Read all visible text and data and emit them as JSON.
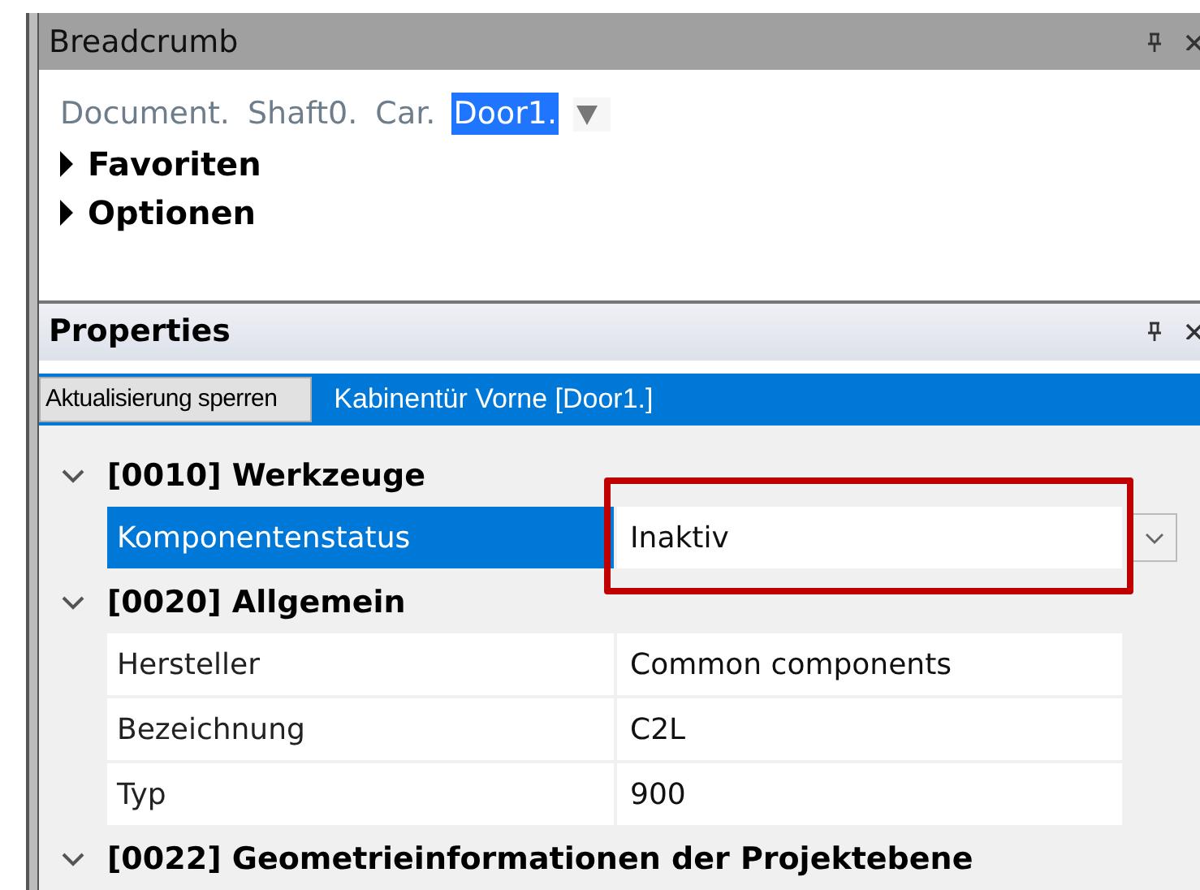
{
  "breadcrumb_panel": {
    "title": "Breadcrumb",
    "crumbs": [
      {
        "label": "Document.",
        "selected": false
      },
      {
        "label": "Shaft0.",
        "selected": false
      },
      {
        "label": "Car.",
        "selected": false
      },
      {
        "label": "Door1.",
        "selected": true
      }
    ],
    "sections": [
      {
        "label": "Favoriten",
        "expanded": false
      },
      {
        "label": "Optionen",
        "expanded": false
      }
    ]
  },
  "properties_panel": {
    "title": "Properties",
    "lock_button": "Aktualisierung sperren",
    "object_label": "Kabinentür Vorne [Door1.]",
    "rows": [
      {
        "kind": "category",
        "label": "[0010] Werkzeuge",
        "expanded": true
      },
      {
        "kind": "property",
        "label": "Komponentenstatus",
        "value": "Inaktiv",
        "selected": true,
        "dropdown": true,
        "highlighted": true
      },
      {
        "kind": "category",
        "label": "[0020] Allgemein",
        "expanded": true
      },
      {
        "kind": "property",
        "label": "Hersteller",
        "value": "Common components",
        "selected": false,
        "dropdown": false,
        "highlighted": false
      },
      {
        "kind": "property",
        "label": "Bezeichnung",
        "value": "C2L",
        "selected": false,
        "dropdown": false,
        "highlighted": false
      },
      {
        "kind": "property",
        "label": "Typ",
        "value": "900",
        "selected": false,
        "dropdown": false,
        "highlighted": false
      },
      {
        "kind": "category",
        "label": "[0022] Geometrieinformationen der Projektebene",
        "expanded": true
      }
    ]
  }
}
